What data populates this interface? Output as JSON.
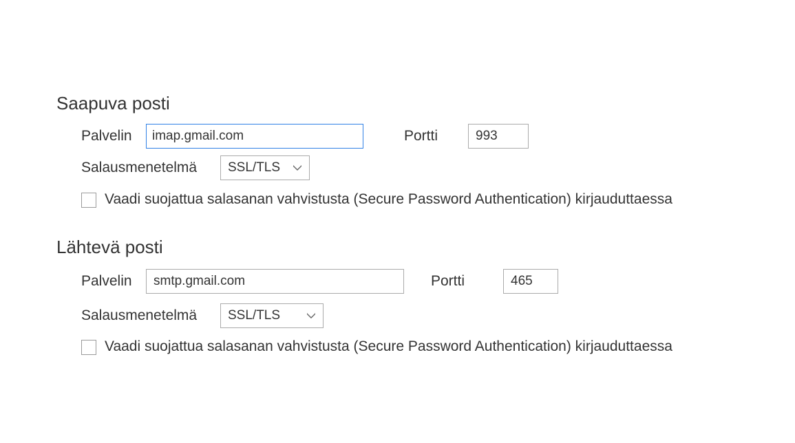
{
  "incoming": {
    "title": "Saapuva posti",
    "server_label": "Palvelin",
    "server_value": "imap.gmail.com",
    "port_label": "Portti",
    "port_value": "993",
    "encryption_label": "Salausmenetelmä",
    "encryption_value": "SSL/TLS",
    "spa_label": "Vaadi suojattua salasanan vahvistusta (Secure Password Authentication) kirjauduttaessa"
  },
  "outgoing": {
    "title": "Lähtevä posti",
    "server_label": "Palvelin",
    "server_value": "smtp.gmail.com",
    "port_label": "Portti",
    "port_value": "465",
    "encryption_label": "Salausmenetelmä",
    "encryption_value": "SSL/TLS",
    "spa_label": "Vaadi suojattua salasanan vahvistusta (Secure Password Authentication) kirjauduttaessa"
  }
}
